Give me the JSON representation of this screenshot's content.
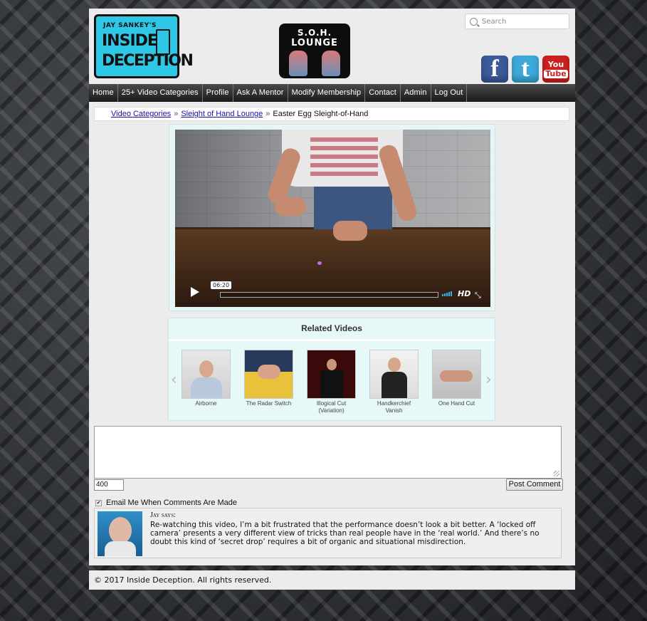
{
  "header": {
    "logo_main": {
      "small": "JAY SANKEY'S",
      "line1": "INSIDE",
      "line2": "DECEPTION"
    },
    "logo_soh": {
      "line1": "S.O.H.",
      "line2": "LOUNGE"
    },
    "search_placeholder": "Search",
    "social": {
      "facebook": "f",
      "twitter": "t",
      "youtube_top": "You",
      "youtube_bottom": "Tube"
    }
  },
  "nav": {
    "items": [
      "Home",
      "25+ Video Categories",
      "Profile",
      "Ask A Mentor",
      "Modify Membership",
      "Contact",
      "Admin",
      "Log Out"
    ]
  },
  "breadcrumb": {
    "link1": "Video Categories",
    "sep": "»",
    "link2": "Sleight of Hand Lounge",
    "current": "Easter Egg Sleight-of-Hand"
  },
  "video": {
    "time": "06:20",
    "hd_label": "HD",
    "fullscreen_icon": "⤡",
    "volume_level": 1.0
  },
  "related": {
    "title": "Related Videos",
    "prev": "‹",
    "next": "›",
    "videos": [
      {
        "label": "Airborne"
      },
      {
        "label": "The Radar Switch"
      },
      {
        "label": "Illogical Cut (Variation)"
      },
      {
        "label": "Handkerchief Vanish"
      },
      {
        "label": "One Hand Cut"
      }
    ]
  },
  "comment_form": {
    "char_count": "400",
    "post_button": "Post Comment",
    "email_me_label": "Email Me When Comments Are Made",
    "email_checked": true
  },
  "comments": [
    {
      "author": "Jay",
      "says": "says:",
      "text": "Re-watching this video, I’m a bit frustrated that the performance doesn’t look a bit better. A ‘locked off camera’ presents a very different view of tricks than real people have in the ‘real world.’ And there’s no doubt this kind of ‘secret drop’ requires a bit of organic and situational misdirection."
    }
  ],
  "footer": {
    "text": "© 2017 Inside Deception. All rights reserved."
  },
  "colors": {
    "logo_bg": "#2ec7e6",
    "nav_bg": "#222222",
    "link": "#1a0dab",
    "video_frame": "#e6f6f6"
  }
}
